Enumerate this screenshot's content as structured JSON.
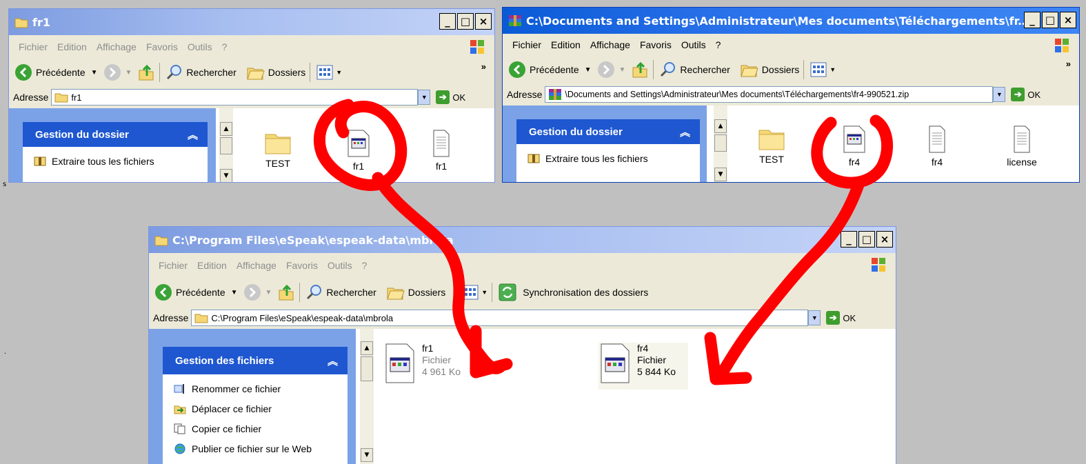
{
  "windows": {
    "fr1": {
      "title": "fr1",
      "menu": [
        "Fichier",
        "Edition",
        "Affichage",
        "Favoris",
        "Outils",
        "?"
      ],
      "toolbar": {
        "back": "Précédente",
        "search": "Rechercher",
        "folders": "Dossiers"
      },
      "address": {
        "label": "Adresse",
        "value": "fr1",
        "go": "OK"
      },
      "task_header": "Gestion du dossier",
      "task_items": [
        "Extraire tous les fichiers"
      ],
      "files": [
        "TEST",
        "fr1",
        "fr1"
      ]
    },
    "zip": {
      "title": "C:\\Documents and Settings\\Administrateur\\Mes documents\\Téléchargements\\fr...",
      "menu": [
        "Fichier",
        "Edition",
        "Affichage",
        "Favoris",
        "Outils",
        "?"
      ],
      "toolbar": {
        "back": "Précédente",
        "search": "Rechercher",
        "folders": "Dossiers"
      },
      "address": {
        "label": "Adresse",
        "value": "\\Documents and Settings\\Administrateur\\Mes documents\\Téléchargements\\fr4-990521.zip",
        "go": "OK"
      },
      "task_header": "Gestion du dossier",
      "task_items": [
        "Extraire tous les fichiers"
      ],
      "files": [
        "TEST",
        "fr4",
        "fr4",
        "license"
      ]
    },
    "mbrola": {
      "title": "C:\\Program Files\\eSpeak\\espeak-data\\mbrola",
      "menu": [
        "Fichier",
        "Edition",
        "Affichage",
        "Favoris",
        "Outils",
        "?"
      ],
      "toolbar": {
        "back": "Précédente",
        "search": "Rechercher",
        "folders": "Dossiers",
        "sync": "Synchronisation des dossiers"
      },
      "address": {
        "label": "Adresse",
        "value": "C:\\Program Files\\eSpeak\\espeak-data\\mbrola",
        "go": "OK"
      },
      "task_header": "Gestion des fichiers",
      "task_items": [
        "Renommer ce fichier",
        "Déplacer ce fichier",
        "Copier ce fichier",
        "Publier ce fichier sur le Web"
      ],
      "tiles": [
        {
          "name": "fr1",
          "type": "Fichier",
          "size": "4 961 Ko"
        },
        {
          "name": "fr4",
          "type": "Fichier",
          "size": "5 844 Ko"
        }
      ]
    }
  },
  "colors": {
    "annotation": "#ff0000",
    "desktop": "#c0c0c0",
    "active_title": "#0a5ad6",
    "task_blue": "#1e57d0"
  }
}
